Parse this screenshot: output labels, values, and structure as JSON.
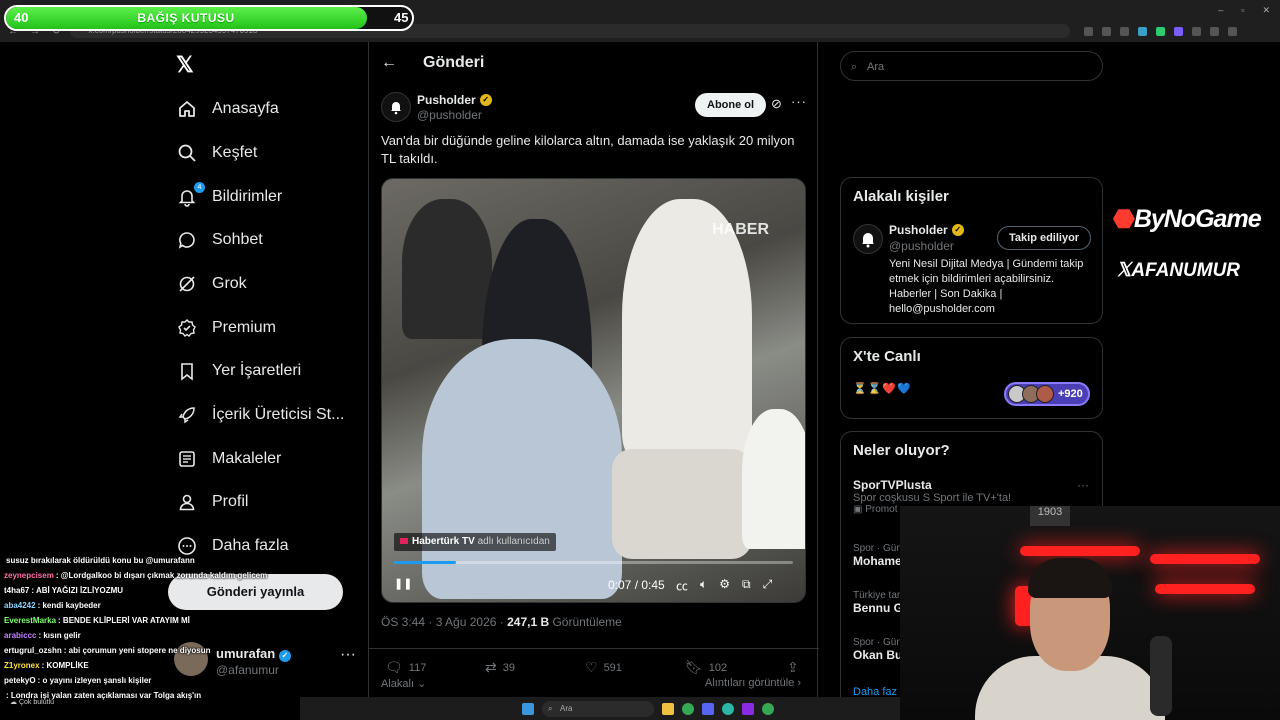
{
  "browser": {
    "url": "x.com/pusholder/status/2084259234597470913",
    "window_controls": [
      "–",
      "▫",
      "✕"
    ]
  },
  "donation": {
    "title": "BAĞIŞ KUTUSU",
    "current": "40",
    "goal": "45",
    "progress": 0.89,
    "color": "#2bd21f"
  },
  "nav": {
    "items": [
      {
        "label": "Anasayfa",
        "icon": "home-icon"
      },
      {
        "label": "Keşfet",
        "icon": "search-icon"
      },
      {
        "label": "Bildirimler",
        "icon": "bell-icon",
        "badge": "4"
      },
      {
        "label": "Sohbet",
        "icon": "chat-icon"
      },
      {
        "label": "Grok",
        "icon": "grok-icon"
      },
      {
        "label": "Premium",
        "icon": "premium-icon"
      },
      {
        "label": "Yer İşaretleri",
        "icon": "bookmark-icon"
      },
      {
        "label": "İçerik Üreticisi St...",
        "icon": "rocket-icon"
      },
      {
        "label": "Makaleler",
        "icon": "article-icon"
      },
      {
        "label": "Profil",
        "icon": "profile-icon"
      },
      {
        "label": "Daha fazla",
        "icon": "more-circle-icon"
      }
    ],
    "post_button": "Gönderi yayınla",
    "account": {
      "name": "umurafan",
      "handle": "@afanumur",
      "more": "···"
    }
  },
  "post": {
    "header_title": "Gönderi",
    "author_name": "Pusholder",
    "author_handle": "@pusholder",
    "subscribe_label": "Abone ol",
    "text": "Van'da bir düğünde geline kilolarca altın, damada ise yaklaşık 20 milyon TL takıldı.",
    "video": {
      "watermark": "HABER",
      "source_channel": "Habertürk TV",
      "source_suffix": "adlı kullanıcıdan",
      "time": "0:07 / 0:45",
      "progress": 0.156
    },
    "time": "ÖS 3:44 · 3 Ağu 2026 ·",
    "views_count": "247,1 B",
    "views_label": "Görüntüleme",
    "replies": "117",
    "reposts": "39",
    "likes": "591",
    "bookmarks": "102",
    "relevant_label": "Alakalı",
    "quotes_label": "Alıntıları görüntüle"
  },
  "sidebar": {
    "search_placeholder": "Ara",
    "relevant": {
      "title": "Alakalı kişiler",
      "name": "Pusholder",
      "handle": "@pusholder",
      "follow_label": "Takip ediliyor",
      "bio": "Yeni Nesil Dijital Medya | Gündemi takip etmek için bildirimleri açabilirsiniz. Haberler | Son Dakika | hello@pusholder.com"
    },
    "live": {
      "title": "X'te Canlı",
      "emojis": "⏳⌛❤️💙",
      "count": "+920"
    },
    "trends": {
      "title": "Neler oluyor?",
      "items": [
        {
          "category": "",
          "name": "SporTVPlusta",
          "desc": "Spor coşkusu S Sport ile TV+'ta!",
          "promo": "Promot"
        },
        {
          "category": "Spor · Gün",
          "name": "Mohame",
          "desc": "",
          "promo": ""
        },
        {
          "category": "Türkiye tar",
          "name": "Bennu G",
          "desc": "",
          "promo": ""
        },
        {
          "category": "Spor · Gün",
          "name": "Okan Bu",
          "desc": "",
          "promo": ""
        }
      ],
      "more_label": "Daha faz"
    }
  },
  "overlay": {
    "brand1": "ByNoGame",
    "brand2": "AFANUMUR",
    "rack_label": "1903"
  },
  "chat": [
    {
      "user": "",
      "msg": "susuz bırakılarak öldürüldü konu bu @umurafann",
      "color": "#ffffff"
    },
    {
      "user": "zeynepcisem",
      "msg": ": @Lordgalkoo bi dışarı çıkmak zorunda kaldım gelicem",
      "color": "#ff6fa8"
    },
    {
      "user": "t4ha67",
      "msg": ": ABİ YAĞIZI İZLİYOZMU",
      "color": "#ffffff"
    },
    {
      "user": "aba4242",
      "msg": ": kendi kaybeder",
      "color": "#8fd3ff"
    },
    {
      "user": "EverestMarka",
      "msg": ": BENDE KLİPLERİ VAR ATAYIM Mİ",
      "color": "#7dff6f"
    },
    {
      "user": "arabiccc",
      "msg": ": kısın gelir",
      "color": "#c080ff"
    },
    {
      "user": "ertugrul_ozshn",
      "msg": ": abi çorumun yeni stopere ne diyosun",
      "color": "#ffffff"
    },
    {
      "user": "Z1yronex",
      "msg": ": KOMPLİKE",
      "color": "#ffe14a"
    },
    {
      "user": "petekyO",
      "msg": ": o yayını izleyen şanslı kişiler",
      "color": "#ffffff"
    },
    {
      "user": "",
      "msg": ": Londra işi yalan zaten açıklaması var Tolga akış'ın",
      "color": "#ff4040"
    }
  ],
  "taskbar": {
    "search": "Ara",
    "weather": "Çok bulutlu"
  }
}
